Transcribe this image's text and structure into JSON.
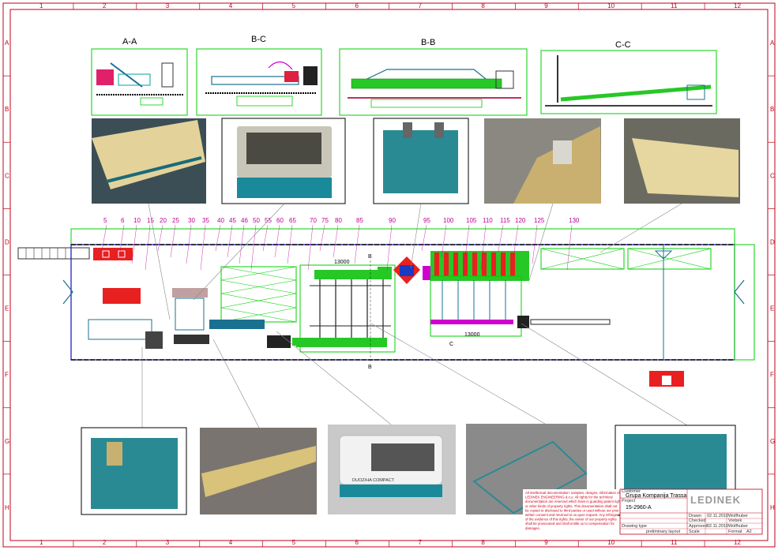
{
  "frame": {
    "columns": [
      "1",
      "2",
      "3",
      "4",
      "5",
      "6",
      "7",
      "8",
      "9",
      "10",
      "11",
      "12"
    ],
    "rows": [
      "A",
      "B",
      "C",
      "D",
      "E",
      "F",
      "G",
      "H"
    ]
  },
  "sections": {
    "aa": "A-A",
    "bc": "B-C",
    "bb": "B-B",
    "cc": "C-C"
  },
  "position_numbers": [
    "5",
    "6",
    "10",
    "15",
    "20",
    "25",
    "30",
    "35",
    "40",
    "45",
    "46",
    "50",
    "55",
    "60",
    "65",
    "70",
    "75",
    "80",
    "85",
    "90",
    "95",
    "100",
    "105",
    "110",
    "115",
    "120",
    "125",
    "130"
  ],
  "dimensions": {
    "left_len": "13000",
    "right_len": "13000"
  },
  "section_marks": {
    "b_top": "B",
    "b_bottom": "B",
    "c_bottom": "C"
  },
  "machine_labels": {
    "compact": "DUOZ/HA COMPACT"
  },
  "title_block": {
    "logo": "LEDINEK",
    "customer_label": "Customer",
    "customer": "Grupa Kompanija Trassa",
    "project_label": "Project",
    "project": "15-2960-A",
    "drawn_label": "Drawn",
    "drawn_date": "02.11.2010",
    "drawn_by": "Wolfhuber",
    "checked_label": "Checked",
    "checked_by": "Vrebek",
    "approved_label": "Approved",
    "approved_date": "02.11.2010",
    "approved_by": "Wolfhuber",
    "drawing_type_label": "Drawing type",
    "drawing_type": "preliminary layout",
    "scale_label": "Scale",
    "format_label": "Format",
    "format": "A2",
    "copyright_lines": [
      "All intellectual documentation: samples, designs, information of",
      "LEDINEK ENGINEERING d.o.o. All rights for the technical",
      "documentation are reserved which have in guarding patent rights",
      "or other kinds of property rights. This documentation shall not",
      "be copied or disclosed to third parties or used without our prior",
      "written consent and returned to us upon request. Any infringement",
      "of the evidence of this rights; the owner of our property rights",
      "shall be prosecuted and shall entitle us to compensation for",
      "damages."
    ]
  },
  "colors": {
    "frame": "#c0001a",
    "outline": "#00d000",
    "magenta": "#d000d0",
    "machine_blue": "#1a7090",
    "hall": "#1010c0"
  }
}
